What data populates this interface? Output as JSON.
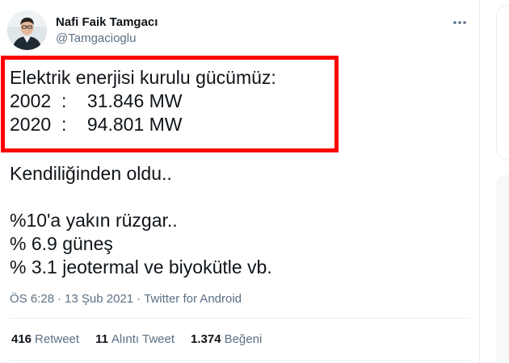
{
  "author": {
    "name": "Nafi Faik Tamgacı",
    "handle": "@Tamgacioglu"
  },
  "tweet": {
    "highlighted_lines": [
      "Elektrik enerjisi kurulu gücümüz:",
      "2002  :    31.846 MW",
      "2020  :    94.801 MW"
    ],
    "body_lines": [
      "Kendiliğinden oldu..",
      "%10'a yakın rüzgar..",
      "% 6.9 güneş",
      "% 3.1 jeotermal ve biyokütle vb."
    ],
    "highlight_color": "#ff0000"
  },
  "meta": {
    "time": "ÖS 6:28",
    "date": "13 Şub 2021",
    "separator": "·",
    "source": "Twitter for Android"
  },
  "stats": {
    "retweets": {
      "count": "416",
      "label": "Retweet"
    },
    "quotes": {
      "count": "11",
      "label": "Alıntı Tweet"
    },
    "likes": {
      "count": "1.374",
      "label": "Beğeni"
    }
  },
  "icons": {
    "more": "more-horizontal-icon",
    "avatar": "profile-photo"
  },
  "colors": {
    "text": "#0f1419",
    "secondary": "#5b7083",
    "divider": "#ebeef0"
  }
}
